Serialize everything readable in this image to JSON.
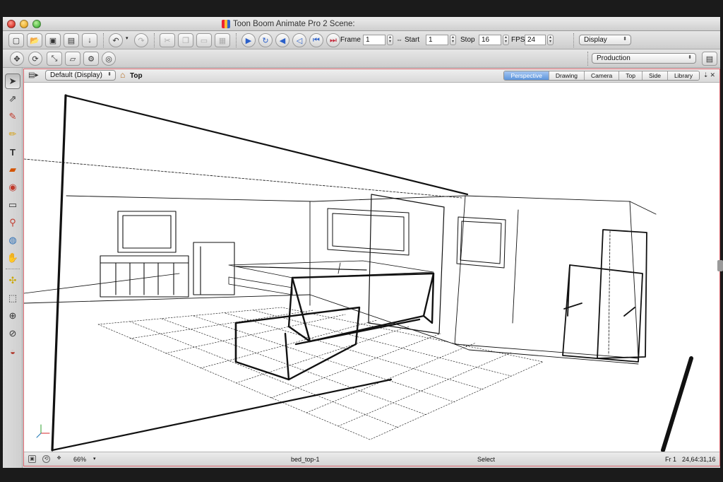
{
  "window": {
    "title": "Toon Boom Animate Pro 2 Scene:"
  },
  "toolbar1": {
    "frame_label": "Frame",
    "frame_value": "1",
    "start_label": "Start",
    "start_value": "1",
    "stop_label": "Stop",
    "stop_value": "16",
    "fps_label": "FPS",
    "fps_value": "24",
    "display_dropdown": "Display"
  },
  "toolbar2": {
    "production_dropdown": "Production"
  },
  "view": {
    "display_dropdown": "Default (Display)",
    "location": "Top",
    "tabs": [
      "Perspective",
      "Drawing",
      "Camera",
      "Top",
      "Side",
      "Library"
    ],
    "active_tab": "Perspective"
  },
  "status": {
    "zoom": "66%",
    "layer": "bed_top-1",
    "tool": "Select",
    "frame": "Fr 1",
    "coords": "24,64:31,16"
  },
  "colors": {
    "active_tab": "#5d95dc",
    "panel_border": "#d9636b"
  }
}
